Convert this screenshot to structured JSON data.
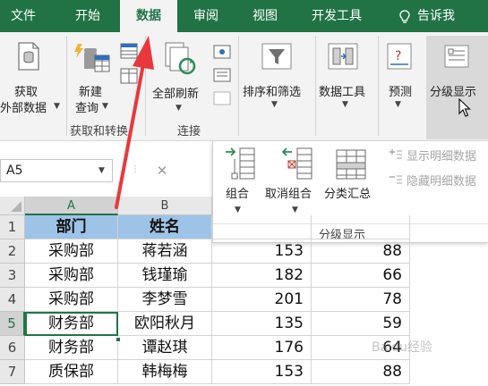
{
  "tabs": {
    "file": "文件",
    "home": "开始",
    "data": "数据",
    "review": "审阅",
    "view": "视图",
    "developer": "开发工具",
    "tellme": "告诉我"
  },
  "ribbon": {
    "get_external_1": "获取",
    "get_external_2": "外部数据",
    "new_query_1": "新建",
    "new_query_2": "查询",
    "refresh_all": "全部刷新",
    "group_get_transform": "获取和转换",
    "group_connections": "连接",
    "sort_filter": "排序和筛选",
    "data_tools": "数据工具",
    "forecast": "预测",
    "outline": "分级显示"
  },
  "outline_panel": {
    "group": "组合",
    "ungroup": "取消组合",
    "subtotal": "分类汇总",
    "show_detail": "显示明细数据",
    "hide_detail": "隐藏明细数据",
    "footer": "分级显示"
  },
  "namebox": {
    "value": "A5",
    "cancel_symbol": "✕"
  },
  "grid": {
    "columns": [
      "A",
      "B"
    ],
    "rows": [
      {
        "num": "1",
        "dept": "部门",
        "name": "姓名",
        "v1": "",
        "v2": ""
      },
      {
        "num": "2",
        "dept": "采购部",
        "name": "蒋若涵",
        "v1": "153",
        "v2": "88"
      },
      {
        "num": "3",
        "dept": "采购部",
        "name": "钱瑾瑜",
        "v1": "182",
        "v2": "66"
      },
      {
        "num": "4",
        "dept": "采购部",
        "name": "李梦雪",
        "v1": "201",
        "v2": "78"
      },
      {
        "num": "5",
        "dept": "财务部",
        "name": "欧阳秋月",
        "v1": "135",
        "v2": "59"
      },
      {
        "num": "6",
        "dept": "财务部",
        "name": "谭赵琪",
        "v1": "176",
        "v2": "64"
      },
      {
        "num": "7",
        "dept": "质保部",
        "name": "韩梅梅",
        "v1": "153",
        "v2": "88"
      }
    ]
  },
  "watermark": "Baidu经验",
  "colors": {
    "brand": "#217346",
    "header_fill": "#9dc3e6",
    "arrow": "#e8383d"
  }
}
